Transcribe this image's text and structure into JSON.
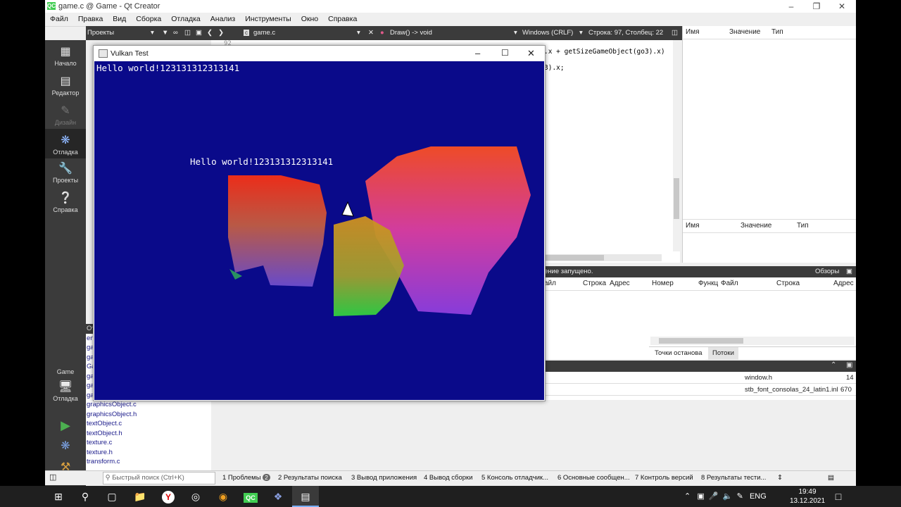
{
  "qt_window": {
    "title": "game.c @ Game - Qt Creator",
    "logo_text": "QC",
    "menu": [
      "Файл",
      "Правка",
      "Вид",
      "Сборка",
      "Отладка",
      "Анализ",
      "Инструменты",
      "Окно",
      "Справка"
    ]
  },
  "toolbar": {
    "projects_label": "Проекты",
    "file_name": "game.c",
    "function": "Draw() -> void",
    "line_ending": "Windows (CRLF)",
    "cursor_pos": "Строка: 97, Столбец: 22"
  },
  "modes": [
    {
      "label": "Начало",
      "icon": "grid-icon"
    },
    {
      "label": "Редактор",
      "icon": "editor-icon"
    },
    {
      "label": "Дизайн",
      "icon": "design-icon"
    },
    {
      "label": "Отладка",
      "icon": "debug-icon"
    },
    {
      "label": "Проекты",
      "icon": "wrench-icon"
    },
    {
      "label": "Справка",
      "icon": "help-icon"
    }
  ],
  "kit": {
    "project": "Game",
    "mode": "Отладка"
  },
  "code": {
    "line_number": "92",
    "line1": ".x + getSizeGameObject(go3).x)",
    "line2": "3).x;"
  },
  "locals": {
    "col_name": "Имя",
    "col_value": "Значение",
    "col_type": "Тип"
  },
  "expressions": {
    "col_name": "Имя",
    "col_value": "Значение",
    "col_type": "Тип"
  },
  "debugger": {
    "status": "ение запущено.",
    "views_label": "Обзоры",
    "stack_cols": [
      "айл",
      "Строка",
      "Адрес"
    ],
    "thread_cols": [
      "Номер",
      "Функц",
      "Файл",
      "Строка",
      "Адрес"
    ],
    "tabs": [
      "Точки останова",
      "Потоки"
    ]
  },
  "open_files": [
    {
      "name": "window.h",
      "line": "14"
    },
    {
      "name": "stb_font_consolas_24_latin1.inl",
      "line": "670"
    }
  ],
  "project_tree": {
    "header": "От",
    "items": [
      "en",
      "ga",
      "ga",
      "Ga",
      "ga",
      "ga",
      "ga",
      "graphicsObject.c",
      "graphicsObject.h",
      "textObject.c",
      "textObject.h",
      "texture.c",
      "texture.h",
      "transform.c"
    ]
  },
  "bottom_bar": {
    "search_placeholder": "Быстрый поиск (Ctrl+K)",
    "tabs": [
      "1  Проблемы",
      "2  Результаты поиска",
      "3  Вывод приложения",
      "4  Вывод сборки",
      "5  Консоль отладчик...",
      "6  Основные сообщен...",
      "7  Контроль версий",
      "8  Результаты тести..."
    ],
    "problems_badge": "2"
  },
  "vulkan_window": {
    "title": "Vulkan Test",
    "text1": "Hello world!123131312313141",
    "text2": "Hello world!123131312313141",
    "bg_color": "#0a0a8a"
  },
  "taskbar": {
    "language": "ENG",
    "time": "19:49",
    "date": "13.12.2021",
    "apps": [
      "start-icon",
      "search-icon",
      "task-view-icon",
      "explorer-icon",
      "yandex-icon",
      "obs-icon",
      "blender-icon",
      "qtcreator-icon",
      "visual-studio-icon",
      "vulkan-app-icon"
    ]
  }
}
